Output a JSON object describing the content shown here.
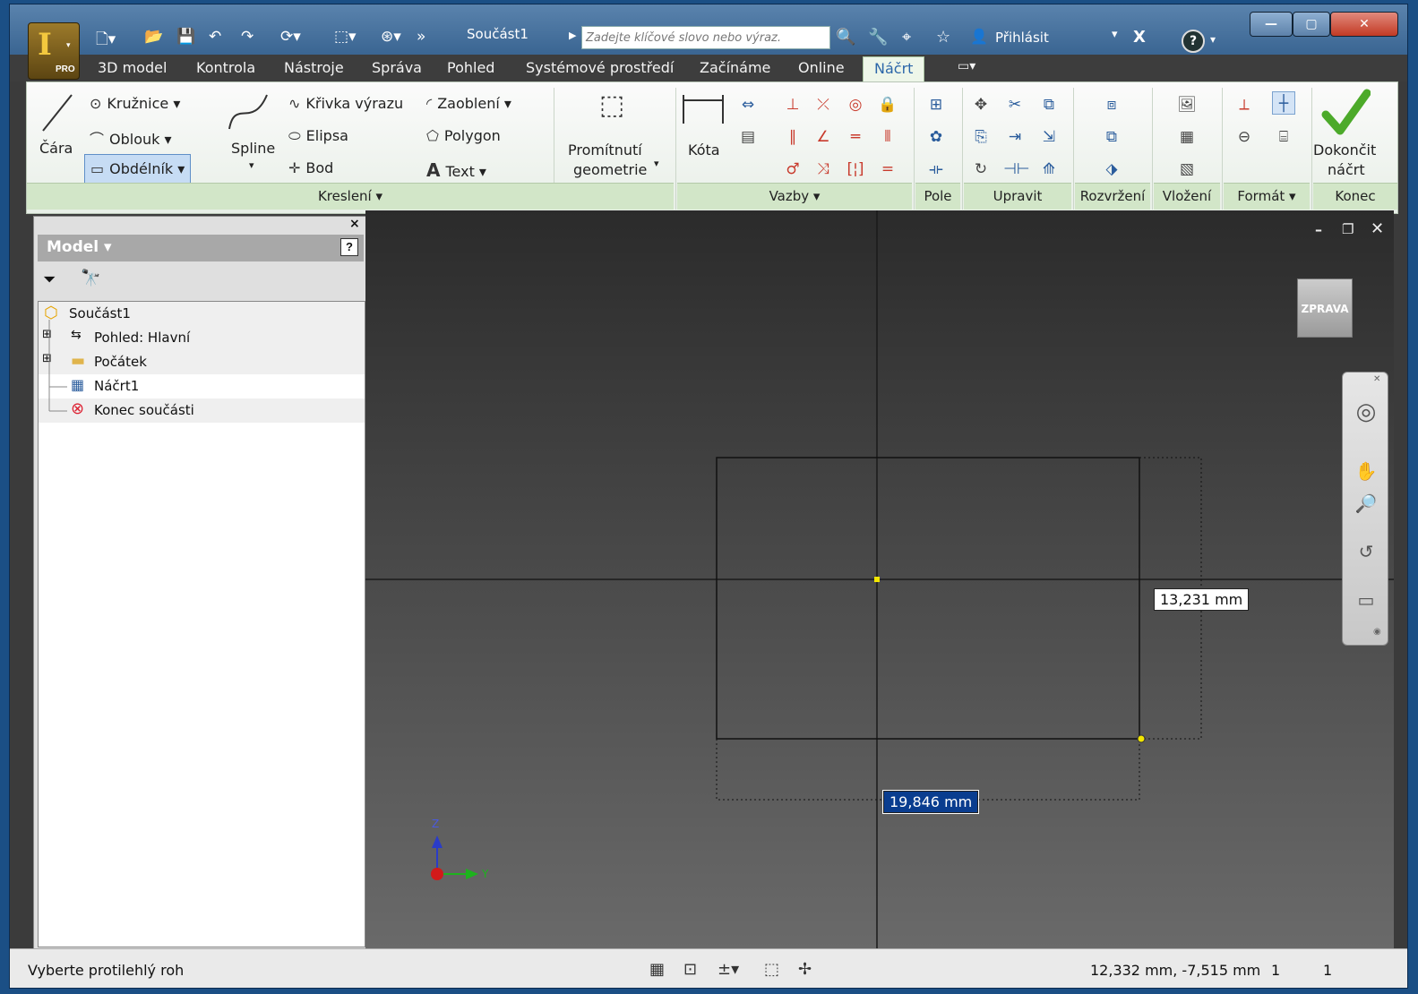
{
  "app": {
    "title": "Součást1",
    "pro_label": "PRO",
    "app_letter": "I",
    "search_placeholder": "Zadejte klíčové slovo nebo výraz.",
    "signin_label": "Přihlásit",
    "help_label": "?"
  },
  "menu": {
    "tabs": [
      {
        "label": "3D model"
      },
      {
        "label": "Kontrola"
      },
      {
        "label": "Nástroje"
      },
      {
        "label": "Správa"
      },
      {
        "label": "Pohled"
      },
      {
        "label": "Systémové prostředí"
      },
      {
        "label": "Začínáme"
      },
      {
        "label": "Online"
      },
      {
        "label": "Náčrt"
      }
    ],
    "active": "Náčrt"
  },
  "ribbon": {
    "draw": {
      "cara": "Čára",
      "kruznice": "Kružnice",
      "oblouk": "Oblouk",
      "obdelnik": "Obdélník",
      "spline": "Spline",
      "krivka": "Křivka výrazu",
      "elipsa": "Elipsa",
      "bod": "Bod",
      "zaobleni": "Zaoblení",
      "polygon": "Polygon",
      "text": "Text",
      "text_icon": "A",
      "projekce_1": "Promítnutí",
      "projekce_2": "geometrie",
      "kota": "Kóta"
    },
    "finish": {
      "line1": "Dokončit",
      "line2": "náčrt"
    },
    "panels": {
      "kresleni": "Kreslení",
      "vazby": "Vazby",
      "pole": "Pole",
      "upravit": "Upravit",
      "rozvrzeni": "Rozvržení",
      "vlozeni": "Vložení",
      "format": "Formát",
      "konec": "Konec"
    }
  },
  "model": {
    "title": "Model",
    "help": "?",
    "tree": [
      {
        "label": "Součást1"
      },
      {
        "label": "Pohled: Hlavní"
      },
      {
        "label": "Počátek"
      },
      {
        "label": "Náčrt1"
      },
      {
        "label": "Konec součásti"
      }
    ]
  },
  "viewport": {
    "viewcube_label": "ZPRAVA",
    "dim_height": "13,231 mm",
    "dim_width": "19,846 mm",
    "axis_z": "Z",
    "axis_y": "Y"
  },
  "status": {
    "prompt": "Vyberte protilehlý roh",
    "coords": "12,332 mm, -7,515 mm",
    "val1": "1",
    "val2": "1"
  },
  "colors": {
    "accent": "#2c66a9",
    "selection": "#0a3d8f",
    "finish_green": "#4caa2a"
  }
}
